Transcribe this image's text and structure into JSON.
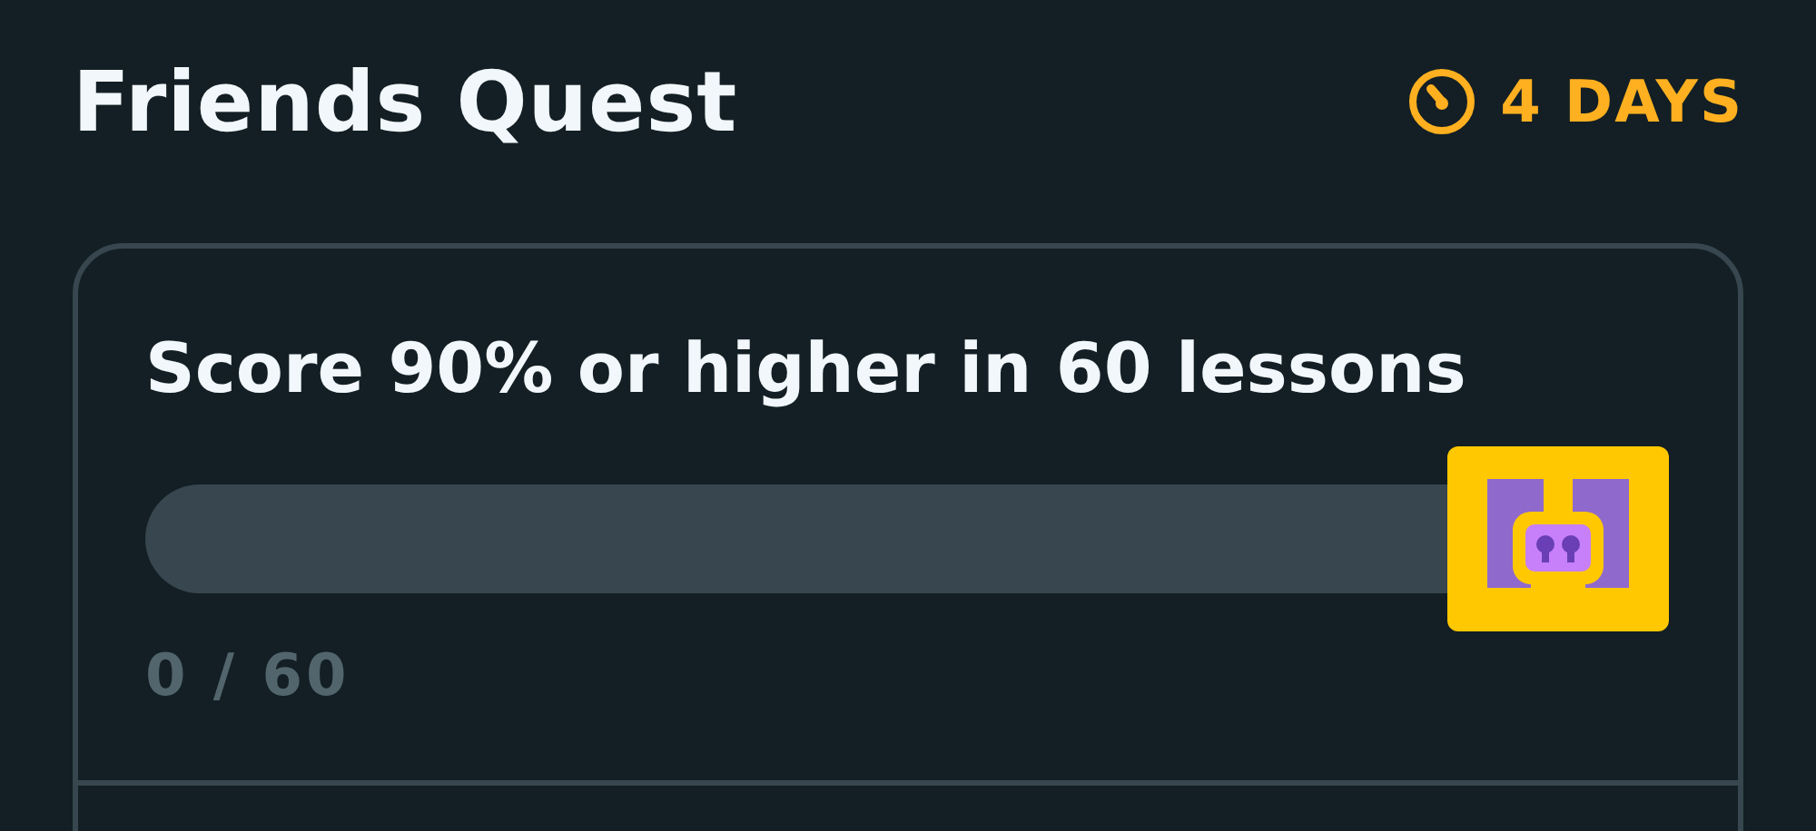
{
  "header": {
    "title": "Friends Quest",
    "timer": "4 DAYS"
  },
  "quest": {
    "description": "Score 90% or higher in 60 lessons",
    "level": 0,
    "progress_text": "0 / 60"
  }
}
